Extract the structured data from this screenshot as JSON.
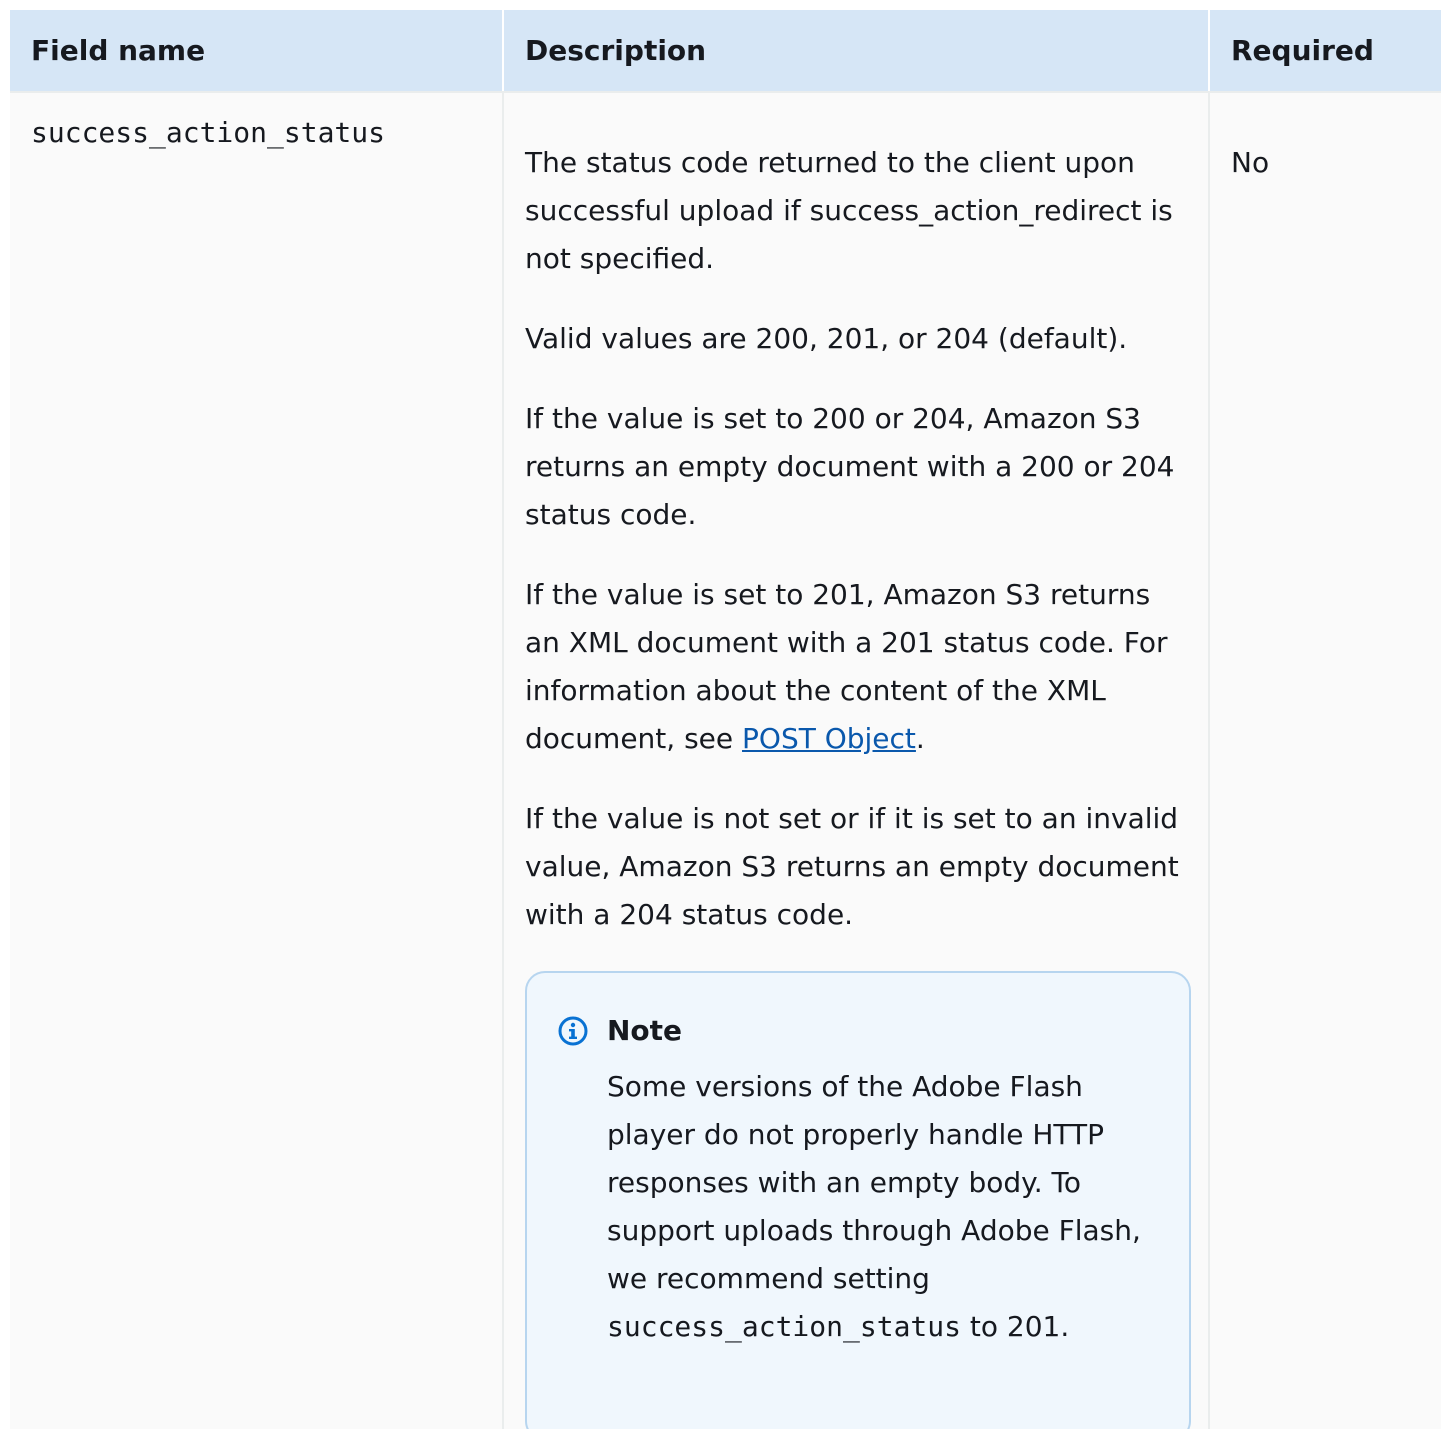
{
  "table": {
    "headers": [
      "Field name",
      "Description",
      "Required"
    ],
    "row": {
      "field_name": "success_action_status",
      "description_paragraphs": [
        "The status code returned to the client upon successful  upload if success_action_redirect is not specified.",
        "Valid values are 200, 201, or 204 (default).",
        "If the value is set to 200 or 204, Amazon S3 returns an empty  document with a 200 or 204 status code."
      ],
      "p4_text": "If the value is set to 201, Amazon S3 returns an XML document  with a 201 status code. For information about the content of the  XML document, see ",
      "p4_link": "POST Object",
      "p4_end": ".",
      "p5_text": "If the value is not set or if it is set to an invalid  value, Amazon S3 returns an empty document with a 204 status code.",
      "required": "No"
    }
  },
  "note": {
    "title": "Note",
    "body_before": "Some versions of the Adobe Flash player do not properly   handle HTTP responses with an empty body. To support uploads  through Adobe Flash, we recommend setting ",
    "code": "success_action_status",
    "body_after": "   to 201.",
    "icon": "info-icon",
    "accent_color": "#0972d3"
  }
}
